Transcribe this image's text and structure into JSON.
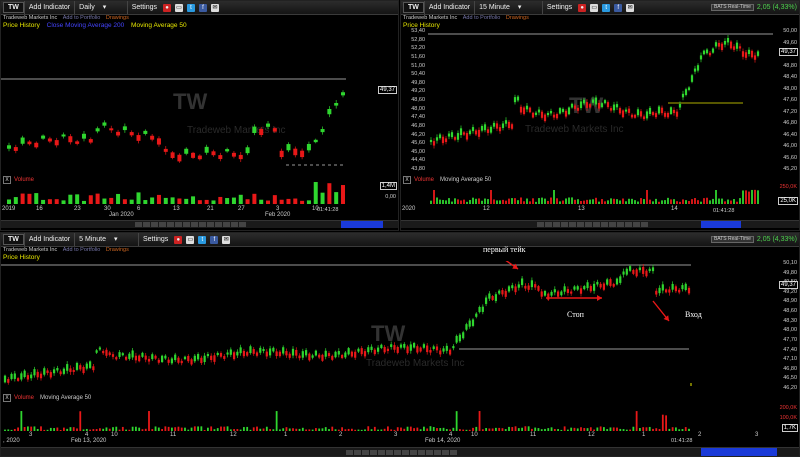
{
  "panels": [
    {
      "id": "daily",
      "symbol": "TW",
      "add_indicator": "Add Indicator",
      "interval": "Daily",
      "settings": "Settings",
      "company": "Tradeweb Markets Inc",
      "add_portfolio": "Add to Portfolio",
      "drawings": "Drawings",
      "price_history": "Price History",
      "ma_line1": "Close Moving Average 200",
      "ma_line2": "Moving Average 50",
      "watermark": "TW",
      "watermark2": "Tradeweb Markets Inc",
      "price_tag": "49,37",
      "vol_label": "Volume",
      "vol_tag": "1,4M",
      "vol_zero": "0,00",
      "x_labels": [
        "2019",
        "16",
        "23",
        "30",
        "Jan 2020",
        "6",
        "13",
        "21",
        "27",
        "3",
        "Feb 2020",
        "10"
      ],
      "time": "01:41:28"
    },
    {
      "id": "15min",
      "symbol": "TW",
      "add_indicator": "Add Indicator",
      "interval": "15 Minute",
      "settings": "Settings",
      "company": "Tradeweb Markets Inc",
      "add_portfolio": "Add to Portfolio",
      "drawings": "Drawings",
      "price_history": "Price History",
      "bats": "BATS Real-Time",
      "change": "2,05 (4,33%)",
      "watermark": "TW",
      "watermark2": "Tradeweb Markets Inc",
      "left_axis": [
        "53,40",
        "52,80",
        "52,20",
        "51,60",
        "51,00",
        "50,40",
        "49,80",
        "49,20",
        "48,60",
        "48,00",
        "47,40",
        "46,80",
        "46,20",
        "45,60",
        "45,00",
        "44,40",
        "43,80"
      ],
      "right_axis": [
        "50,00",
        "49,60",
        "49,20",
        "48,80",
        "48,40",
        "48,00",
        "47,60",
        "47,20",
        "46,80",
        "46,40",
        "46,00",
        "45,60",
        "45,20"
      ],
      "price_tag": "49,37",
      "vol_label": "Volume",
      "vol_ma": "Moving Average 50",
      "vol_axis_top": "250,0K",
      "vol_tag": "25,0K",
      "vol_left": [
        "1,4M",
        "0,00"
      ],
      "x_labels": [
        "2020",
        "12",
        "13",
        "14"
      ],
      "time": "01:41:28"
    },
    {
      "id": "5min",
      "symbol": "TW",
      "add_indicator": "Add Indicator",
      "interval": "5 Minute",
      "settings": "Settings",
      "company": "Tradeweb Markets Inc",
      "add_portfolio": "Add to Portfolio",
      "drawings": "Drawings",
      "price_history": "Price History",
      "bats": "BATS Real-Time",
      "change": "2,05 (4,33%)",
      "watermark": "TW",
      "watermark2": "Tradeweb Markets Inc",
      "right_axis": [
        "50,10",
        "49,80",
        "49,50",
        "49,20",
        "48,90",
        "48,60",
        "48,30",
        "48,00",
        "47,70",
        "47,40",
        "47,10",
        "46,80",
        "46,50",
        "46,20"
      ],
      "price_tag": "49,37",
      "vol_label": "Volume",
      "vol_ma": "Moving Average 50",
      "vol_axis": [
        "200,0K",
        "100,0K"
      ],
      "vol_tag": "1,7K",
      "x_labels": [
        ", 2020",
        "3",
        "4",
        "10",
        "Feb 13, 2020",
        "11",
        "12",
        "1",
        "2",
        "3",
        "4",
        "10",
        "Feb 14, 2020",
        "11",
        "12",
        "1",
        "2",
        "3"
      ],
      "time": "01:41:28"
    }
  ],
  "annotations": {
    "first_take": "первый тейк",
    "stop": "Стоп",
    "entry": "Вход"
  },
  "colors": {
    "up": "#2fd62f",
    "down": "#e81818",
    "accent": "#e8e800",
    "scroll": "#1a3ad8"
  }
}
